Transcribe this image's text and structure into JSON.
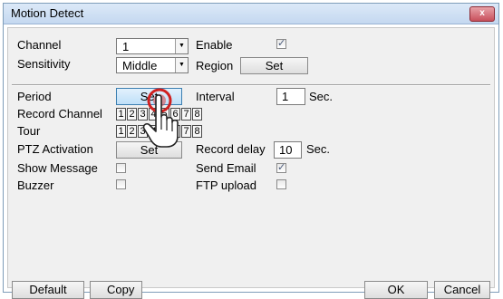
{
  "window": {
    "title": "Motion Detect",
    "close_label": "x"
  },
  "channel": {
    "label": "Channel",
    "value": "1",
    "enable_label": "Enable",
    "enable_checked": true
  },
  "sensitivity": {
    "label": "Sensitivity",
    "value": "Middle",
    "region_label": "Region",
    "region_button": "Set"
  },
  "period": {
    "label": "Period",
    "button": "Set",
    "interval_label": "Interval",
    "interval_value": "1",
    "interval_unit": "Sec."
  },
  "record_channel": {
    "label": "Record Channel",
    "channels": [
      "1",
      "2",
      "3",
      "4",
      "5",
      "6",
      "7",
      "8"
    ]
  },
  "tour": {
    "label": "Tour",
    "channels": [
      "1",
      "2",
      "3",
      "4",
      "5",
      "6",
      "7",
      "8"
    ]
  },
  "ptz": {
    "label": "PTZ Activation",
    "button": "Set",
    "record_delay_label": "Record delay",
    "record_delay_value": "10",
    "record_delay_unit": "Sec."
  },
  "show_message": {
    "label": "Show Message",
    "checked": false
  },
  "send_email": {
    "label": "Send Email",
    "checked": true
  },
  "buzzer": {
    "label": "Buzzer",
    "checked": false
  },
  "ftp_upload": {
    "label": "FTP upload",
    "checked": false
  },
  "footer": {
    "default": "Default",
    "copy": "Copy",
    "ok": "OK",
    "cancel": "Cancel"
  },
  "icons": {
    "cursor": "hand-pointer-icon",
    "close": "close-icon",
    "dropdown": "triangle-down-icon"
  },
  "colors": {
    "titlebar": "#c4d8f0",
    "close": "#c8505c",
    "highlight": "#bfe0f8",
    "pointer_ring": "#d02020"
  }
}
